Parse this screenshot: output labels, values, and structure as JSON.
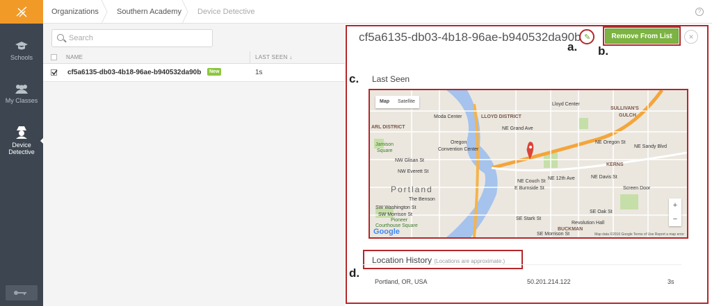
{
  "nav": {
    "items": [
      {
        "label": "Schools",
        "icon": "graduation-cap-icon"
      },
      {
        "label": "My Classes",
        "icon": "users-icon"
      },
      {
        "label": "Device Detective",
        "icon": "detective-icon"
      }
    ]
  },
  "breadcrumb": {
    "items": [
      "Organizations",
      "Southern Academy",
      "Device Detective"
    ]
  },
  "list": {
    "search_placeholder": "Search",
    "columns": [
      "NAME",
      "LAST SEEN ↓"
    ],
    "rows": [
      {
        "name": "cf5a6135-db03-4b18-96ae-b940532da90b",
        "badge": "New",
        "last_seen": "1s"
      }
    ]
  },
  "detail": {
    "title": "cf5a6135-db03-4b18-96ae-b940532da90b",
    "remove_label": "Remove From List",
    "close_glyph": "×",
    "annotations": [
      "a.",
      "b.",
      "c.",
      "d."
    ],
    "last_seen_title": "Last Seen",
    "map": {
      "toggle": [
        "Map",
        "Satellite"
      ],
      "labels": [
        "Lloyd Center",
        "SULLIVAN'S",
        "GULCH",
        "Moda Center",
        "LLOYD DISTRICT",
        "ARL DISTRICT",
        "Jamison",
        "Square",
        "Oregon",
        "Convention Center",
        "KERNS",
        "Portland",
        "The Benson",
        "Screen Door",
        "Revolution Hall",
        "BUCKMAN",
        "Pioneer",
        "Courthouse Square",
        "NW Glisan St",
        "NW Everett St",
        "SW Washington St",
        "SW Morrison St",
        "NE Couch St",
        "E Burnside St",
        "SE Stark St",
        "SE Oak St",
        "NE Grand Ave",
        "NE 12th Ave",
        "NE Oregon St",
        "NE Davis St",
        "NE Sandy Blvd",
        "SE Morrison St"
      ],
      "footer": "Map data ©2016 Google   Terms of Use   Report a map error",
      "google": "Google"
    },
    "history_title": "Location History",
    "history_note": "(Locations are approximate.)",
    "history": [
      {
        "place": "Portland, OR, USA",
        "ip": "50.201.214.122",
        "age": "3s"
      }
    ]
  }
}
